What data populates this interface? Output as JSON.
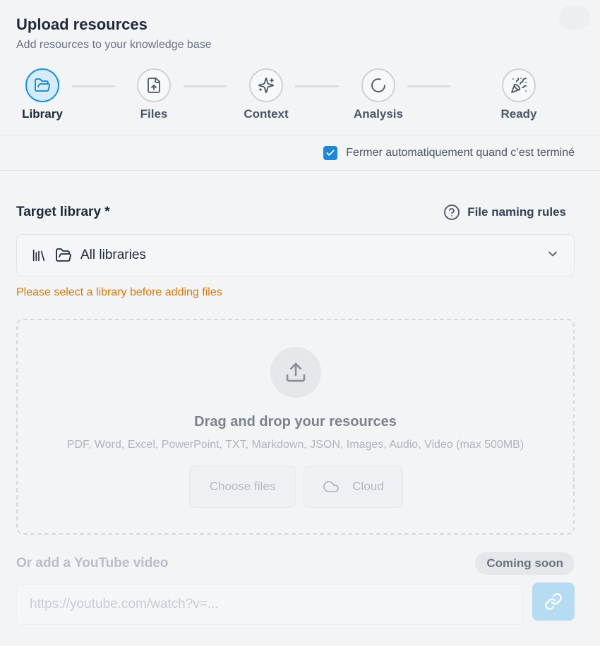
{
  "header": {
    "title": "Upload resources",
    "subtitle": "Add resources to your knowledge base"
  },
  "steps": [
    {
      "label": "Library",
      "icon": "folder-open-icon",
      "active": true
    },
    {
      "label": "Files",
      "icon": "file-upload-icon",
      "active": false
    },
    {
      "label": "Context",
      "icon": "sparkles-icon",
      "active": false
    },
    {
      "label": "Analysis",
      "icon": "loader-icon",
      "active": false
    },
    {
      "label": "Ready",
      "icon": "party-popper-icon",
      "active": false
    }
  ],
  "autoclose": {
    "checked": true,
    "label": "Fermer automatiquement quand c’est terminé"
  },
  "target": {
    "label": "Target library *",
    "naming_rules": "File naming rules",
    "selected": "All libraries",
    "warning": "Please select a library before adding files"
  },
  "dropzone": {
    "title": "Drag and drop your resources",
    "formats": "PDF, Word, Excel, PowerPoint, TXT, Markdown, JSON, Images, Audio, Video (max 500MB)",
    "choose_files": "Choose files",
    "cloud": "Cloud"
  },
  "youtube": {
    "label": "Or add a YouTube video",
    "badge": "Coming soon",
    "placeholder": "https://youtube.com/watch?v=..."
  },
  "colors": {
    "accent": "#1e88d2",
    "warning": "#d4780a",
    "background": "#f3f4f6"
  }
}
